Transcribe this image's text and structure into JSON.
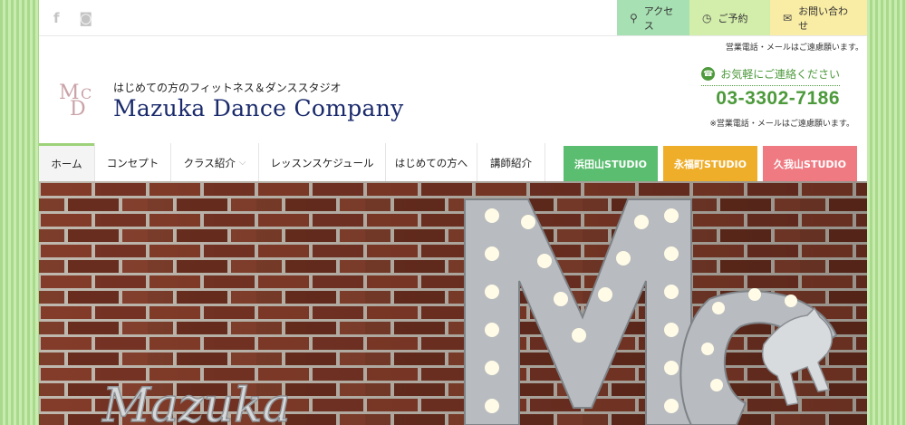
{
  "topbar": {
    "social_icons": [
      "facebook-icon",
      "instagram-icon"
    ],
    "links": [
      {
        "label": "アクセス",
        "icon": "map-pin-icon",
        "color": "#a7e0b2"
      },
      {
        "label": "ご予約",
        "icon": "clock-icon",
        "color": "#d3edab"
      },
      {
        "label": "お問い合わせ",
        "icon": "mail-icon",
        "color": "#f9eca5"
      }
    ],
    "note": "営業電話・メールはご遠慮願います。"
  },
  "header": {
    "logo_letters": {
      "m": "M",
      "d": "D",
      "c": "C"
    },
    "tagline": "はじめての方のフィットネス＆ダンススタジオ",
    "brand": "Mazuka Dance Company",
    "contact_label": "お気軽にご連絡ください",
    "phone": "03-3302-7186",
    "phone_note": "※営業電話・メールはご遠慮願います。"
  },
  "nav": {
    "items": [
      "ホーム",
      "コンセプト",
      "クラス紹介",
      "レッスンスケジュール",
      "はじめての方へ",
      "講師紹介"
    ],
    "studios": [
      {
        "label": "浜田山STUDIO",
        "color": "#5bbd70"
      },
      {
        "label": "永福町STUDIO",
        "color": "#efae2a"
      },
      {
        "label": "久我山STUDIO",
        "color": "#ef7a82"
      }
    ]
  },
  "hero": {
    "sign_text": "Mazuka",
    "sign_letters": "MDC"
  },
  "colors": {
    "accent_green": "#4d9a3c",
    "brand_navy": "#1a2a6c",
    "stripe_green": "#a9d98a"
  }
}
